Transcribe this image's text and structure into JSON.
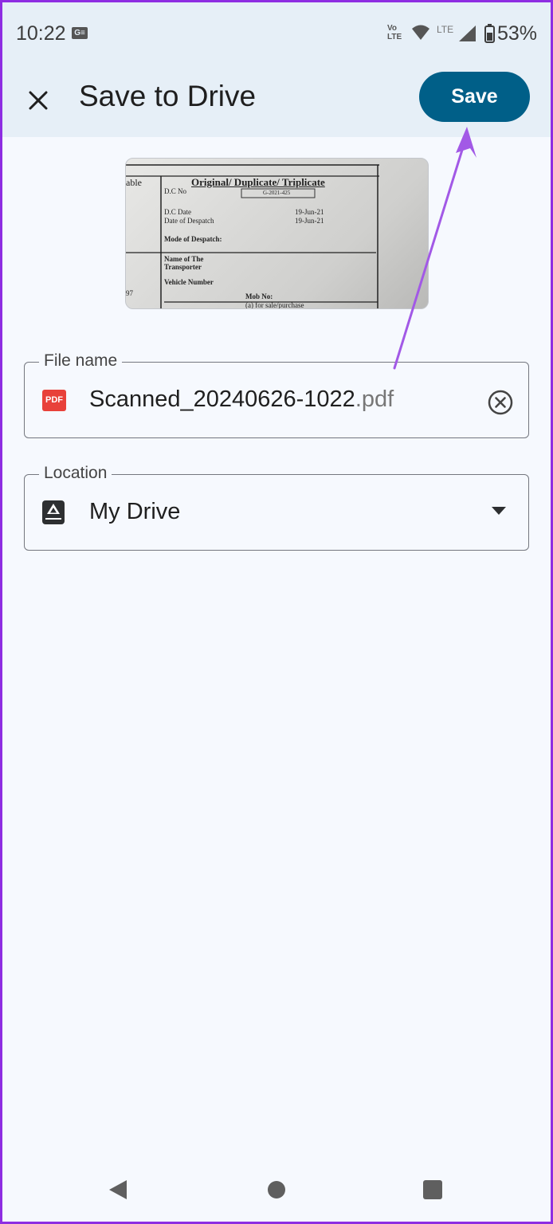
{
  "status_bar": {
    "time": "10:22",
    "notification_icon": "G≡",
    "volte": "Vo\nLTE",
    "lte": "LTE",
    "battery": "53%"
  },
  "app_bar": {
    "close_icon": "close-icon",
    "title": "Save to Drive",
    "save_label": "Save",
    "save_color": "#005f88"
  },
  "preview": {
    "header": "Original/ Duplicate/ Triplicate",
    "side_label": "able",
    "dc_no_label": "D.C  No",
    "dc_no_value": "G-2021-425",
    "dc_date_label": "D.C Date",
    "dc_date_value": "19-Jun-21",
    "despatch_date_label": "Date of Despatch",
    "despatch_date_value": "19-Jun-21",
    "despatch_mode_label": "Mode of Despatch:",
    "transporter_label_1": "Name of The",
    "transporter_label_2": "Transporter",
    "vehicle_label": "Vehicle Number",
    "mob_label": "Mob No:",
    "sale_label": "(a) for sale/purchase",
    "left_num": "97"
  },
  "file_name_field": {
    "label": "File name",
    "badge": "PDF",
    "name": "Scanned_20240626-1022",
    "extension": ".pdf",
    "clear_icon": "clear-circle-icon"
  },
  "location_field": {
    "label": "Location",
    "icon": "drive-icon",
    "value": "My Drive",
    "dropdown_icon": "dropdown-arrow-icon"
  },
  "annotation": {
    "color": "#a259e6"
  },
  "nav_bar": {
    "back_icon": "back-icon",
    "home_icon": "home-icon",
    "recents_icon": "recents-icon"
  }
}
